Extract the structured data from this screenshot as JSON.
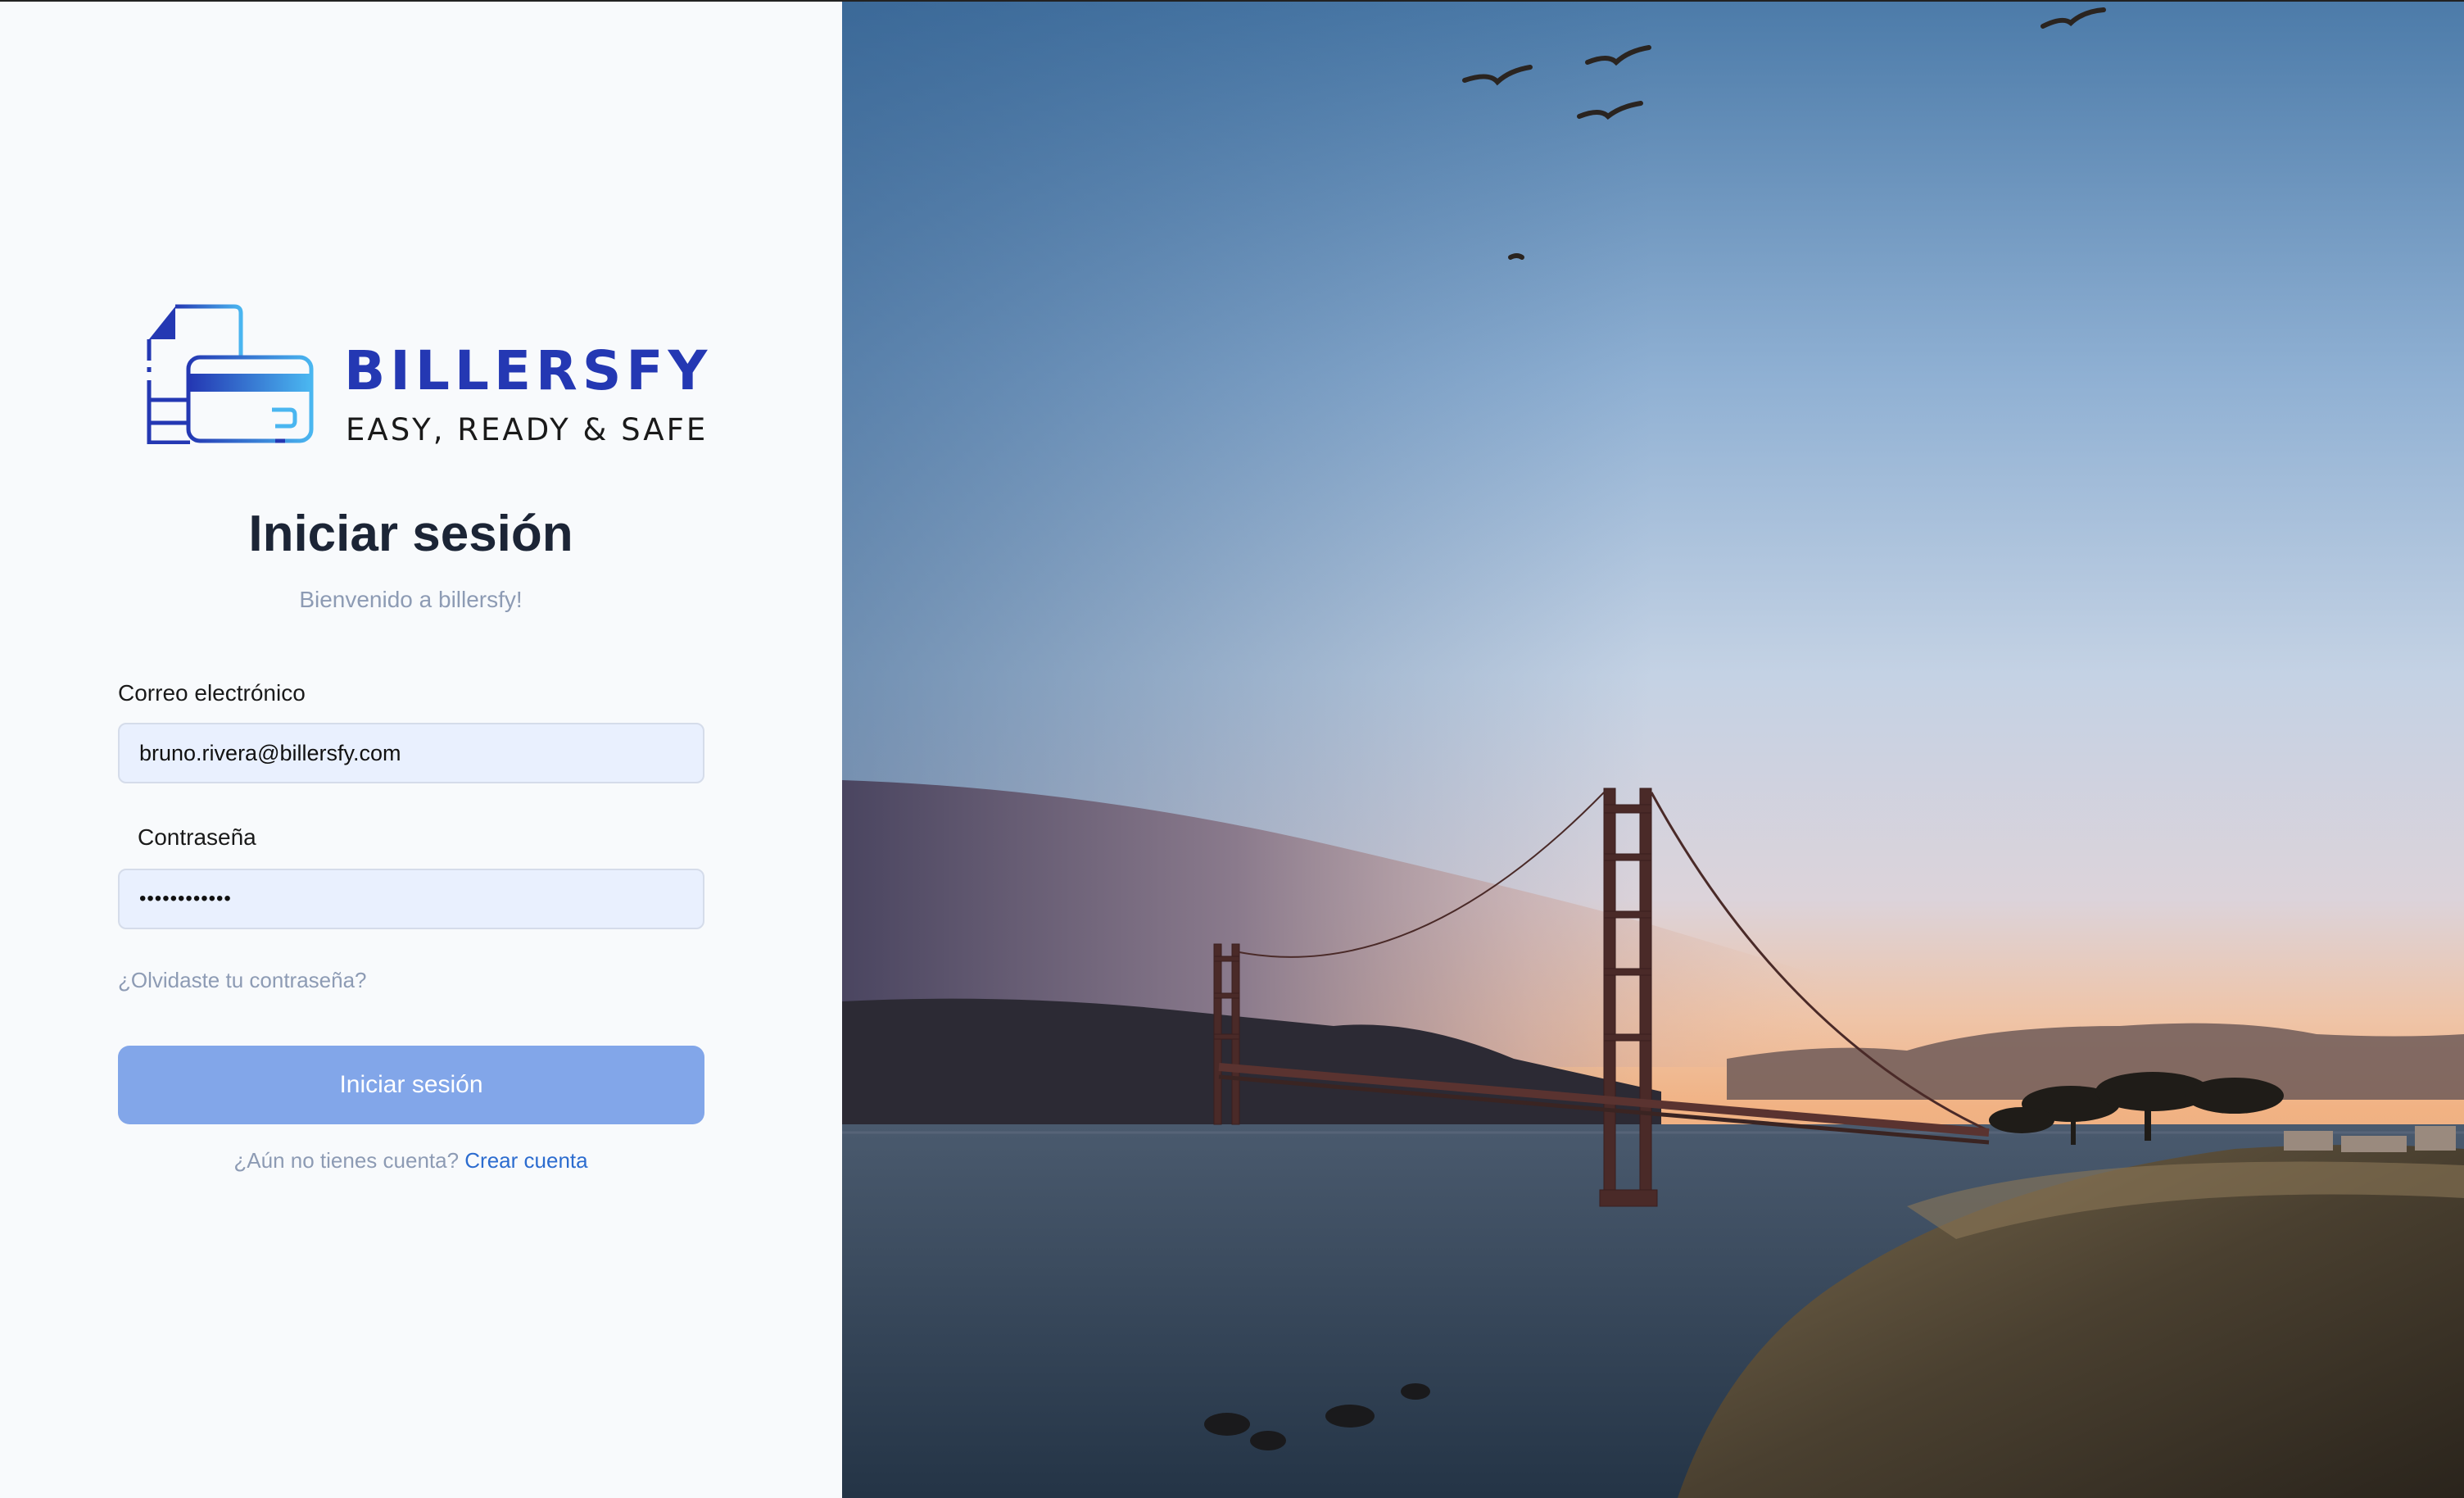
{
  "brand": {
    "name": "BILLERSFY",
    "tagline": "EASY, READY & SAFE",
    "primary_color": "#2438b3",
    "accent_color": "#4ab6f0",
    "logo_icon": "card-document-icon"
  },
  "login": {
    "title": "Iniciar sesión",
    "subtitle": "Bienvenido a billersfy!",
    "email_label": "Correo electrónico",
    "email_value": "bruno.rivera@billersfy.com",
    "password_label": "Contraseña",
    "password_value": "••••••••••••",
    "forgot_password": "¿Olvidaste tu contraseña?",
    "submit_label": "Iniciar sesión",
    "submit_color": "#82a6e9",
    "signup_prompt": "¿Aún no tienes cuenta?",
    "signup_link": "Crear cuenta"
  },
  "hero": {
    "image": "golden-gate-bridge-sunset-photo"
  }
}
